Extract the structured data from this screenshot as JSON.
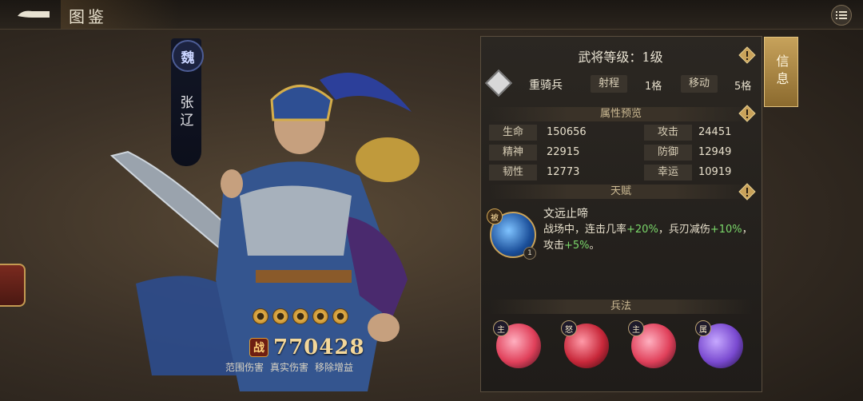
{
  "header": {
    "title": "图鉴"
  },
  "hero": {
    "kingdom": "魏",
    "name": "张辽",
    "stars": 5,
    "power_icon": "战",
    "power": "770428",
    "tags": [
      "范围伤害",
      "真实伤害",
      "移除增益"
    ]
  },
  "panel": {
    "level_title": "武将等级：1级",
    "info_tab": "信息",
    "unit": {
      "name": "重骑兵",
      "range_label": "射程",
      "range_value": "1格",
      "move_label": "移动",
      "move_value": "5格"
    },
    "attributes_header": "属性预览",
    "attributes": [
      {
        "label": "生命",
        "value": "150656"
      },
      {
        "label": "攻击",
        "value": "24451"
      },
      {
        "label": "精神",
        "value": "22915"
      },
      {
        "label": "防御",
        "value": "12949"
      },
      {
        "label": "韧性",
        "value": "12773"
      },
      {
        "label": "幸运",
        "value": "10919"
      }
    ],
    "talent_header": "天赋",
    "talent": {
      "badge": "被",
      "level": "1",
      "name": "文远止啼",
      "desc_1": "战场中，连击几率",
      "val_1": "+20%",
      "desc_2": "，兵刃减伤",
      "val_2": "+10%",
      "desc_3": "，攻击",
      "val_3": "+5%",
      "desc_4": "。"
    },
    "skills_header": "兵法",
    "skills": [
      {
        "badge": "主",
        "color": "#e0405a"
      },
      {
        "badge": "怒",
        "color": "#c8283a"
      },
      {
        "badge": "主",
        "color": "#e0405a"
      },
      {
        "badge": "属",
        "color": "#7a4ad0"
      }
    ]
  },
  "colors": {
    "accent": "#c7a25b",
    "panel_bg": "#2b2722",
    "green": "#7bd86a"
  }
}
